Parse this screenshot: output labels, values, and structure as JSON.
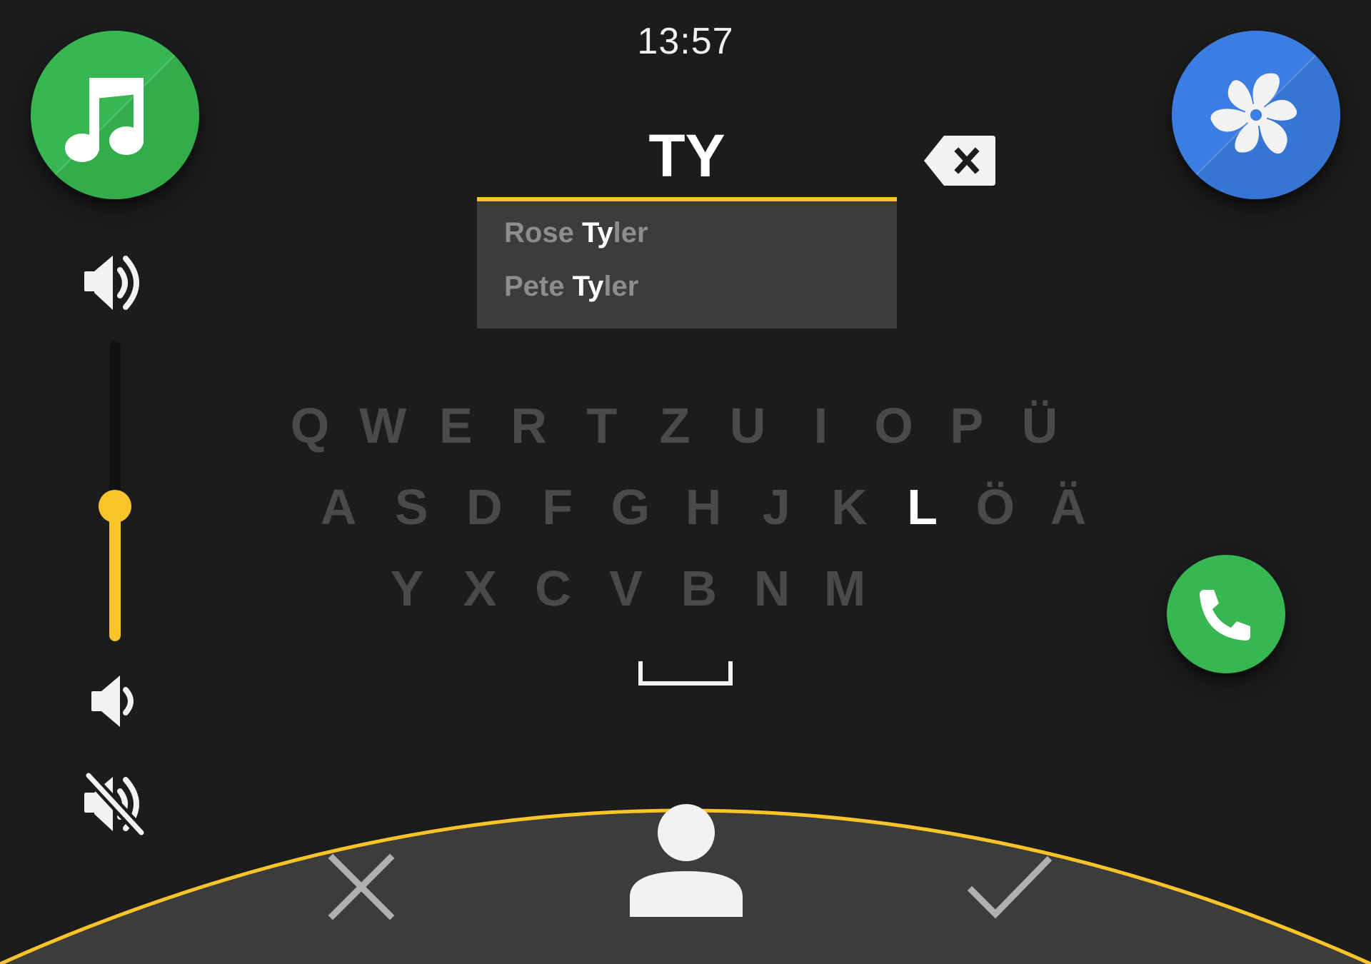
{
  "status_bar": {
    "time": "13:57"
  },
  "colors": {
    "accent_yellow": "#f8c42a",
    "music_green": "#37b751",
    "fan_blue": "#3b7de2",
    "phone_green": "#37b751",
    "background": "#1c1c1c",
    "panel": "#3c3c3c",
    "key_inactive": "#4a4a4a"
  },
  "apps": {
    "music": {
      "icon": "music-note-icon"
    },
    "climate": {
      "icon": "fan-icon"
    },
    "phone": {
      "icon": "phone-icon"
    }
  },
  "search": {
    "input_value": "TY",
    "backspace_icon": "backspace-icon",
    "suggestions": [
      {
        "prefix": "Rose ",
        "match": "Ty",
        "rest": "ler"
      },
      {
        "prefix": "Pete ",
        "match": "Ty",
        "rest": "ler"
      }
    ]
  },
  "keyboard": {
    "rows": [
      [
        "Q",
        "W",
        "E",
        "R",
        "T",
        "Z",
        "U",
        "I",
        "O",
        "P",
        "Ü"
      ],
      [
        "A",
        "S",
        "D",
        "F",
        "G",
        "H",
        "J",
        "K",
        "L",
        "Ö",
        "Ä"
      ],
      [
        "Y",
        "X",
        "C",
        "V",
        "B",
        "N",
        "M"
      ]
    ],
    "highlighted_key": "L",
    "space_icon": "space-bar-icon"
  },
  "volume": {
    "level": 0.45,
    "icons": [
      "volume-up-icon",
      "volume-down-icon",
      "volume-mute-icon"
    ]
  },
  "bottom_bar": {
    "cancel_icon": "close-icon",
    "contact_icon": "person-icon",
    "confirm_icon": "check-icon"
  }
}
